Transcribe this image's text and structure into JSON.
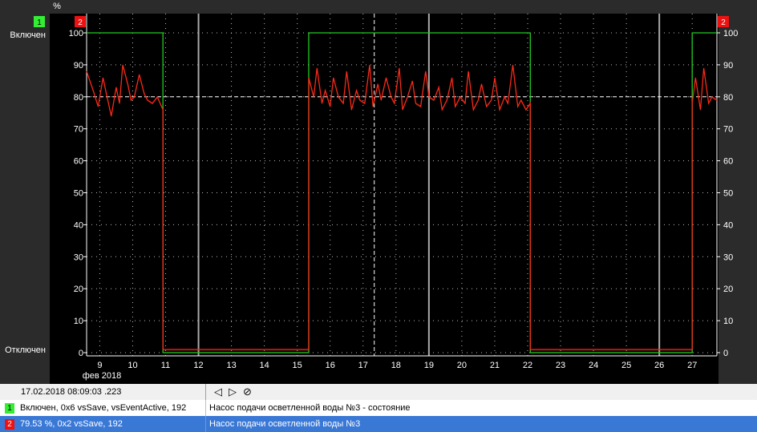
{
  "colors": {
    "state": "#22cc22",
    "value": "#ff1a1a",
    "value_secondary": "#e06010",
    "grid": "#bbbbbb",
    "reference": "#ffffff",
    "plot_bg": "#000000"
  },
  "chart_data": {
    "type": "line",
    "left_axis": {
      "badge": "1",
      "unit": "%",
      "on_label": "Включен",
      "off_label": "Отключен"
    },
    "right_axis": {
      "badge": "2"
    },
    "yticks": [
      "100",
      "90",
      "80",
      "70",
      "60",
      "50",
      "40",
      "30",
      "20",
      "10",
      "0"
    ],
    "ylim": [
      0,
      100
    ],
    "xticks": [
      "9",
      "10",
      "11",
      "12",
      "13",
      "14",
      "15",
      "16",
      "17",
      "18",
      "19",
      "20",
      "21",
      "22",
      "23",
      "24",
      "25",
      "26",
      "27"
    ],
    "xlim": [
      8.6,
      27.75
    ],
    "x_caption": "фев 2018",
    "reference_y": 80,
    "cursor_x": 17.34,
    "series": [
      {
        "key": "state",
        "x": [
          8.6,
          10.92,
          10.92,
          15.35,
          15.35,
          22.08,
          22.08,
          27.0,
          27.0,
          27.75
        ],
        "values": [
          100,
          100,
          0,
          0,
          100,
          100,
          0,
          0,
          100,
          100
        ]
      },
      {
        "key": "value",
        "x": [
          8.6,
          8.8,
          8.95,
          9.1,
          9.2,
          9.35,
          9.5,
          9.6,
          9.7,
          9.85,
          9.95,
          10.05,
          10.2,
          10.35,
          10.45,
          10.6,
          10.75,
          10.92,
          10.92,
          15.35,
          15.35,
          15.5,
          15.6,
          15.75,
          15.85,
          16.0,
          16.1,
          16.25,
          16.4,
          16.5,
          16.65,
          16.8,
          16.9,
          17.05,
          17.2,
          17.3,
          17.45,
          17.55,
          17.7,
          17.85,
          17.95,
          18.1,
          18.2,
          18.35,
          18.5,
          18.6,
          18.75,
          18.9,
          19.0,
          19.15,
          19.3,
          19.4,
          19.55,
          19.7,
          19.8,
          19.95,
          20.1,
          20.2,
          20.35,
          20.5,
          20.6,
          20.75,
          20.9,
          21.0,
          21.15,
          21.3,
          21.4,
          21.55,
          21.7,
          21.8,
          21.95,
          22.08,
          22.08,
          27.0,
          27.0,
          27.1,
          27.25,
          27.35,
          27.5,
          27.6,
          27.75
        ],
        "values": [
          88,
          82,
          77,
          86,
          81,
          74,
          83,
          78,
          90,
          84,
          79,
          80,
          87,
          81,
          79,
          78,
          80,
          76,
          1,
          1,
          86,
          80,
          89,
          78,
          82,
          77,
          86,
          80,
          78,
          88,
          76,
          82,
          79,
          78,
          90,
          77,
          84,
          79,
          86,
          80,
          78,
          89,
          76,
          80,
          85,
          78,
          77,
          88,
          80,
          79,
          83,
          76,
          79,
          86,
          77,
          80,
          78,
          88,
          76,
          79,
          84,
          77,
          79,
          86,
          76,
          80,
          78,
          90,
          77,
          79,
          76,
          78,
          1,
          1,
          78,
          86,
          76,
          89,
          78,
          80,
          79
        ]
      }
    ]
  },
  "footer": {
    "datetime": "17.02.2018 08:09:03 .223",
    "nav_prev": "◁",
    "nav_next": "▷",
    "nav_stop": "⊘",
    "rows": [
      {
        "badge": "1",
        "value": "Включен, 0x6 vsSave, vsEventActive, 192",
        "name": "Насос подачи осветленной воды №3 - состояние"
      },
      {
        "badge": "2",
        "value": "79.53 %, 0x2 vsSave, 192",
        "name": "Насос подачи осветленной воды №3"
      }
    ]
  }
}
